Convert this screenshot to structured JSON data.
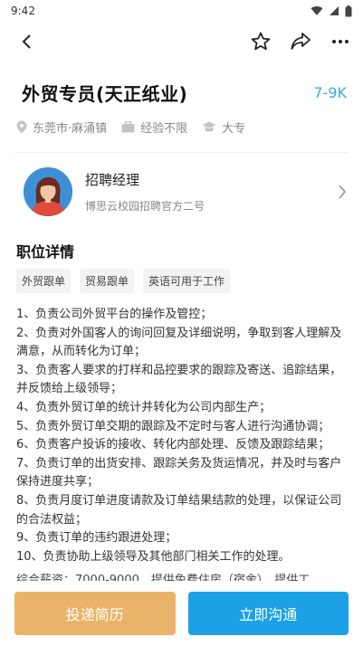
{
  "status_bar": {
    "time": "9:42"
  },
  "job": {
    "title": "外贸专员(天正纸业)",
    "salary": "7-9K",
    "location": "东莞市·麻涌镇",
    "experience": "经验不限",
    "education": "大专"
  },
  "recruiter": {
    "name": "招聘经理",
    "org": "博思云校园招聘官方二号"
  },
  "details": {
    "section_title": "职位详情",
    "tags": [
      "外贸跟单",
      "贸易跟单",
      "英语可用于工作"
    ],
    "lines": [
      "1、负责公司外贸平台的操作及管控；",
      "2、负责对外国客人的询问回复及详细说明，争取到客人理解及满意，从而转化为订单；",
      "3、负责客人要求的打样和品控要求的跟踪及寄送、追踪结果，并反馈给上级领导；",
      "4、负责外贸订单的统计并转化为公司内部生产；",
      "5、负责外贸订单交期的跟踪及不定时与客人进行沟通协调；",
      "6、负责客户投诉的接收、转化内部处理、反馈及跟踪结果；",
      "7、负责订单的出货安排、跟踪关务及货运情况，并及时与客户保持进度共享；",
      "8、负责月度订单进度请款及订单结果结款的处理，以保证公司的合法权益；",
      "9、负责订单的违约跟进处理；",
      "10、负责协助上级领导及其他部门相关工作的处理。"
    ],
    "cut_line": "综合薪资：7000-9000，提供免费住房（宿舍），提供工"
  },
  "actions": {
    "apply_label": "投递简历",
    "chat_label": "立即沟通"
  },
  "colors": {
    "salary": "#3fa7e4",
    "apply": "#e9b46a",
    "chat": "#1da1e6"
  }
}
